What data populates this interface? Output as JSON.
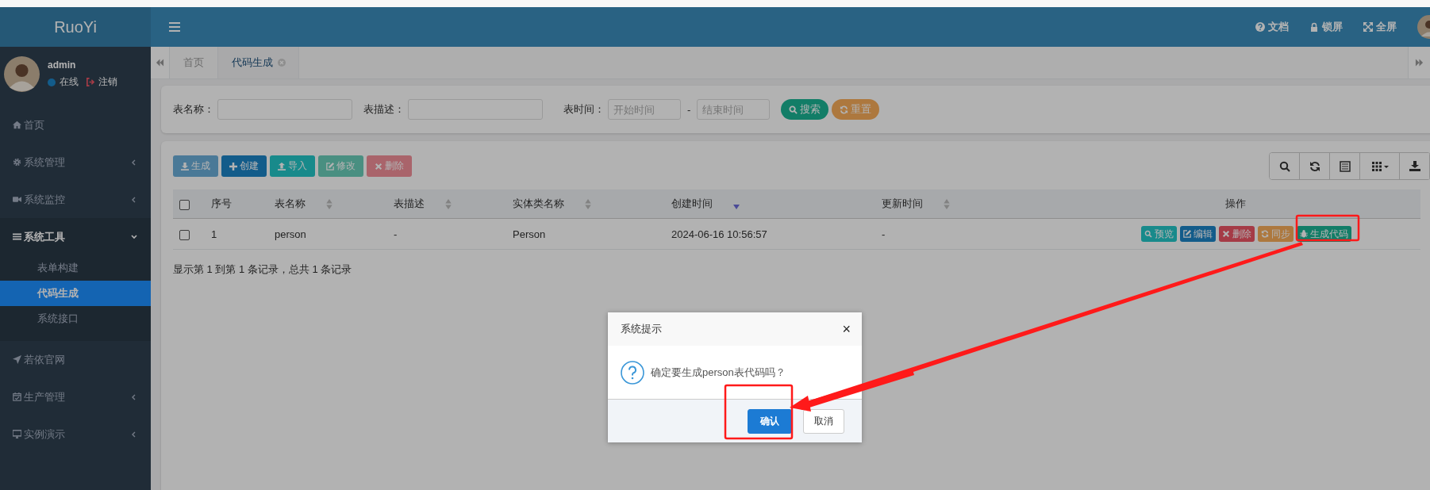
{
  "header": {
    "logo": "RuoYi",
    "links": [
      {
        "label": "文档",
        "kind": "help"
      },
      {
        "label": "锁屏",
        "kind": "lock"
      },
      {
        "label": "全屏",
        "kind": "fullscreen"
      }
    ]
  },
  "user": {
    "name": "admin",
    "status": "在线",
    "logout": "注销"
  },
  "sidebar": {
    "items": [
      {
        "label": "首页",
        "kind": "home"
      },
      {
        "label": "系统管理",
        "kind": "gear",
        "expanded": false
      },
      {
        "label": "系统监控",
        "kind": "camera",
        "expanded": false
      },
      {
        "label": "系统工具",
        "kind": "bars",
        "expanded": true,
        "children": [
          {
            "label": "表单构建",
            "selected": false
          },
          {
            "label": "代码生成",
            "selected": true
          },
          {
            "label": "系统接口",
            "selected": false
          }
        ]
      },
      {
        "label": "若依官网",
        "kind": "plane"
      },
      {
        "label": "生产管理",
        "kind": "calendar",
        "expanded": false
      },
      {
        "label": "实例演示",
        "kind": "desktop",
        "expanded": false
      }
    ]
  },
  "tabs": [
    {
      "label": "首页",
      "selected": false
    },
    {
      "label": "代码生成",
      "selected": true
    }
  ],
  "search": {
    "fields": [
      {
        "label": "表名称：",
        "kind": "text"
      },
      {
        "label": "表描述：",
        "kind": "text"
      },
      {
        "label": "表时间：",
        "kind": "date_range",
        "placeholders": [
          "开始时间",
          "结束时间"
        ],
        "separator": "-"
      }
    ],
    "buttons": [
      {
        "label": "搜索",
        "kind": "search"
      },
      {
        "label": "重置",
        "kind": "reset"
      }
    ]
  },
  "toolbar": {
    "buttons": [
      {
        "label": "生成",
        "kind": "download",
        "disabled": true
      },
      {
        "label": "创建",
        "kind": "plus",
        "disabled": false
      },
      {
        "label": "导入",
        "kind": "upload",
        "disabled": false
      },
      {
        "label": "修改",
        "kind": "edit",
        "disabled": true
      },
      {
        "label": "删除",
        "kind": "remove",
        "disabled": true
      }
    ]
  },
  "table": {
    "header_checked": false,
    "columns": [
      {
        "label": "序号",
        "sortable": false
      },
      {
        "label": "表名称",
        "sortable": true,
        "sorted_desc": false
      },
      {
        "label": "表描述",
        "sortable": true,
        "sorted_desc": false
      },
      {
        "label": "实体类名称",
        "sortable": true,
        "sorted_desc": false
      },
      {
        "label": "创建时间",
        "sortable": true,
        "sorted_desc": true
      },
      {
        "label": "更新时间",
        "sortable": true,
        "sorted_desc": false
      },
      {
        "label": "操作",
        "sortable": false
      }
    ],
    "rows": [
      {
        "checked": false,
        "cells": [
          "1",
          "person",
          "-",
          "Person",
          "2024-06-16 10:56:57",
          "-"
        ],
        "actions": [
          {
            "label": "预览",
            "kind": "preview"
          },
          {
            "label": "编辑",
            "kind": "edit"
          },
          {
            "label": "删除",
            "kind": "remove"
          },
          {
            "label": "同步",
            "kind": "sync"
          },
          {
            "label": "生成代码",
            "kind": "generate"
          }
        ]
      }
    ]
  },
  "pagination": "显示第 1 到第 1 条记录，总共 1 条记录",
  "dialog": {
    "title": "系统提示",
    "close": "×",
    "message": "确定要生成person表代码吗？",
    "buttons": [
      {
        "label": "确认",
        "kind": "primary"
      },
      {
        "label": "取消",
        "kind": "default"
      }
    ]
  }
}
